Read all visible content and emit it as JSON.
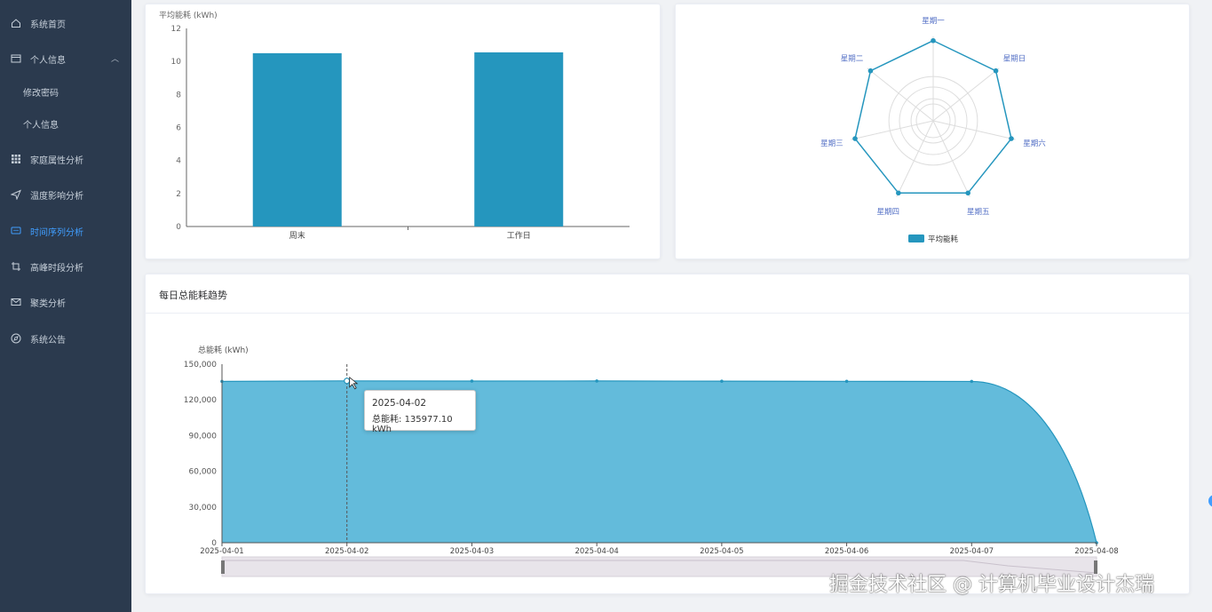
{
  "sidebar": {
    "items": [
      {
        "label": "系统首页",
        "icon": "home-icon"
      },
      {
        "label": "个人信息",
        "icon": "profile-card-icon",
        "expanded": true
      },
      {
        "label": "修改密码",
        "sub": true
      },
      {
        "label": "个人信息",
        "sub": true
      },
      {
        "label": "家庭属性分析",
        "icon": "grid-icon"
      },
      {
        "label": "温度影响分析",
        "icon": "send-icon"
      },
      {
        "label": "时间序列分析",
        "icon": "chat-icon",
        "active": true
      },
      {
        "label": "高峰时段分析",
        "icon": "crop-icon"
      },
      {
        "label": "聚类分析",
        "icon": "mail-icon"
      },
      {
        "label": "系统公告",
        "icon": "compass-icon"
      }
    ],
    "colors": {
      "bg": "#2b3a4e",
      "text": "#c7d0da",
      "active": "#409eff"
    }
  },
  "charts": [
    {
      "type": "bar",
      "ylabel": "平均能耗 (kWh)",
      "categories": [
        "周末",
        "工作日"
      ],
      "values": [
        10.5,
        10.55
      ],
      "ylim": [
        0,
        12
      ],
      "yticks": [
        "0",
        "2",
        "4",
        "6",
        "8",
        "10",
        "12"
      ],
      "color": "#2596be"
    },
    {
      "type": "radar",
      "indicators": [
        "星期一",
        "星期日",
        "星期六",
        "星期五",
        "星期四",
        "星期三",
        "星期二"
      ],
      "values": [
        0.95,
        0.95,
        0.95,
        0.95,
        0.95,
        0.95,
        0.95
      ],
      "legend": "平均能耗",
      "color": "#2596be"
    }
  ],
  "bottom": {
    "title": "每日总能耗趋势",
    "chart_data": {
      "type": "area",
      "ylabel": "总能耗 (kWh)",
      "x": [
        "2025-04-01",
        "2025-04-02",
        "2025-04-03",
        "2025-04-04",
        "2025-04-05",
        "2025-04-06",
        "2025-04-07",
        "2025-04-08"
      ],
      "values": [
        135500,
        135977.1,
        135800,
        135900,
        135700,
        135600,
        135500,
        0
      ],
      "ylim": [
        0,
        150000
      ],
      "yticks": [
        "0",
        "30,000",
        "60,000",
        "90,000",
        "120,000",
        "150,000"
      ],
      "color": "#5bb7d9",
      "line_color": "#2596be"
    },
    "tooltip": {
      "date": "2025-04-02",
      "label": "总能耗:",
      "value": "135977.10 kWh"
    }
  },
  "watermark": "掘金技术社区 @ 计算机毕业设计杰瑞"
}
